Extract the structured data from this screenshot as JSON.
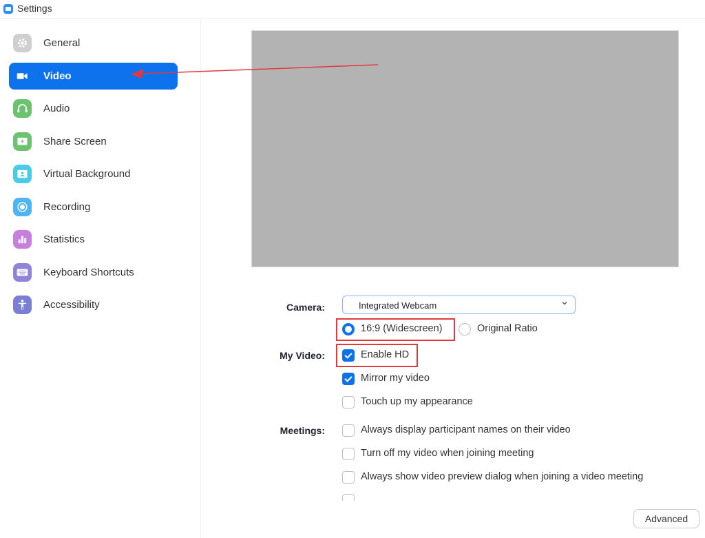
{
  "window": {
    "title": "Settings",
    "app_icon": "zoom-camera-icon"
  },
  "sidebar": {
    "items": [
      {
        "label": "General",
        "icon": "gear-icon",
        "color": "#c9c9c9",
        "active": false
      },
      {
        "label": "Video",
        "icon": "video-camera-icon",
        "color": "#0e72ed",
        "active": true
      },
      {
        "label": "Audio",
        "icon": "headphones-icon",
        "color": "#6cc26f",
        "active": false
      },
      {
        "label": "Share Screen",
        "icon": "share-screen-icon",
        "color": "#6cc26f",
        "active": false
      },
      {
        "label": "Virtual Background",
        "icon": "virtual-background-icon",
        "color": "#4ccbe6",
        "active": false
      },
      {
        "label": "Recording",
        "icon": "record-icon",
        "color": "#4eb5f4",
        "active": false
      },
      {
        "label": "Statistics",
        "icon": "bar-chart-icon",
        "color": "#c77fdc",
        "active": false
      },
      {
        "label": "Keyboard Shortcuts",
        "icon": "keyboard-icon",
        "color": "#8f84d9",
        "active": false
      },
      {
        "label": "Accessibility",
        "icon": "accessibility-icon",
        "color": "#7b7fd4",
        "active": false
      }
    ]
  },
  "video": {
    "camera_label": "Camera:",
    "camera_value": "Integrated Webcam",
    "ratio_options": [
      {
        "label": "16:9 (Widescreen)",
        "selected": true
      },
      {
        "label": "Original Ratio",
        "selected": false
      }
    ],
    "my_video_label": "My Video:",
    "my_video_options": [
      {
        "label": "Enable HD",
        "checked": true
      },
      {
        "label": "Mirror my video",
        "checked": true
      },
      {
        "label": "Touch up my appearance",
        "checked": false
      }
    ],
    "meetings_label": "Meetings:",
    "meetings_options": [
      {
        "label": "Always display participant names on their video",
        "checked": false
      },
      {
        "label": "Turn off my video when joining meeting",
        "checked": false
      },
      {
        "label": "Always show video preview dialog when joining a video meeting",
        "checked": false
      }
    ],
    "advanced_button": "Advanced"
  },
  "annotations": {
    "highlight_color": "#e0393e",
    "arrow_color": "#e0393e"
  }
}
